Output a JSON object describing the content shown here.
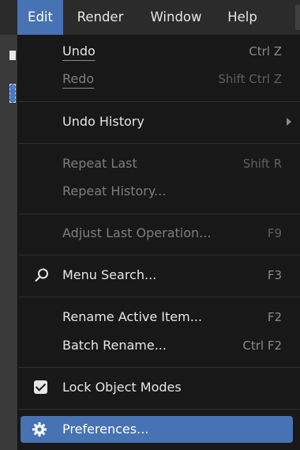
{
  "topbar": {
    "items": [
      {
        "label": "Edit",
        "active": true
      },
      {
        "label": "Render",
        "active": false
      },
      {
        "label": "Window",
        "active": false
      },
      {
        "label": "Help",
        "active": false
      }
    ]
  },
  "menu": {
    "undo": {
      "label": "Undo",
      "shortcut": "Ctrl Z"
    },
    "redo": {
      "label": "Redo",
      "shortcut": "Shift Ctrl Z"
    },
    "undo_history": {
      "label": "Undo History"
    },
    "repeat_last": {
      "label": "Repeat Last",
      "shortcut": "Shift R"
    },
    "repeat_history": {
      "label": "Repeat History..."
    },
    "adjust_last": {
      "label": "Adjust Last Operation...",
      "shortcut": "F9"
    },
    "menu_search": {
      "label": "Menu Search...",
      "shortcut": "F3"
    },
    "rename_active": {
      "label": "Rename Active Item...",
      "shortcut": "F2"
    },
    "batch_rename": {
      "label": "Batch Rename...",
      "shortcut": "Ctrl F2"
    },
    "lock_object_modes": {
      "label": "Lock Object Modes",
      "checked": true
    },
    "preferences": {
      "label": "Preferences..."
    }
  },
  "colors": {
    "accent": "#4772b3",
    "menu_bg": "#181818",
    "topbar_bg": "#2b2b2b",
    "text": "#e6e6e6",
    "disabled_text": "#7d7d7d",
    "shortcut_text": "#8a8a8a"
  },
  "icons": {
    "search": "magnifier-icon",
    "checkbox": "checkbox-checked-icon",
    "preferences": "gear-icon",
    "submenu": "chevron-right-icon"
  }
}
